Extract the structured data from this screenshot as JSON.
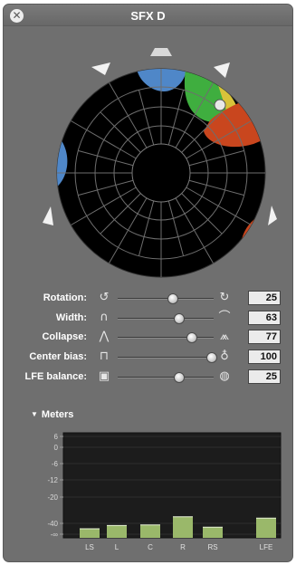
{
  "window": {
    "title": "SFX D",
    "close_glyph": "✕"
  },
  "panner": {
    "position_handle": "panner-position-handle",
    "regions": [
      {
        "name": "blue-top",
        "color": "#4f87c8"
      },
      {
        "name": "green",
        "color": "#3fae3f"
      },
      {
        "name": "yellow",
        "color": "#d8c23a"
      },
      {
        "name": "red",
        "color": "#c9461e"
      },
      {
        "name": "blue-left",
        "color": "#4f87c8"
      }
    ]
  },
  "controls": [
    {
      "id": "rotation",
      "label": "Rotation:",
      "value": "25",
      "fraction": 0.58,
      "icon_left": "rotate-ccw-icon",
      "icon_right": "rotate-cw-icon"
    },
    {
      "id": "width",
      "label": "Width:",
      "value": "63",
      "fraction": 0.64,
      "icon_left": "narrow-width-icon",
      "icon_right": "wide-width-icon"
    },
    {
      "id": "collapse",
      "label": "Collapse:",
      "value": "77",
      "fraction": 0.77,
      "icon_left": "collapse-low-icon",
      "icon_right": "collapse-high-icon"
    },
    {
      "id": "center_bias",
      "label": "Center bias:",
      "value": "100",
      "fraction": 0.98,
      "icon_left": "center-bias-low-icon",
      "icon_right": "center-bias-high-icon"
    },
    {
      "id": "lfe_balance",
      "label": "LFE balance:",
      "value": "25",
      "fraction": 0.64,
      "icon_left": "lfe-low-icon",
      "icon_right": "lfe-high-icon"
    }
  ],
  "meters": {
    "header": "Meters",
    "scale": [
      "6",
      "0",
      "-6",
      "-12",
      "-20",
      "-40",
      "-∞"
    ],
    "channels": [
      "LS",
      "L",
      "C",
      "R",
      "RS",
      "LFE"
    ],
    "levels_db": [
      -50,
      -44,
      -43,
      -35,
      -47,
      -36
    ]
  }
}
